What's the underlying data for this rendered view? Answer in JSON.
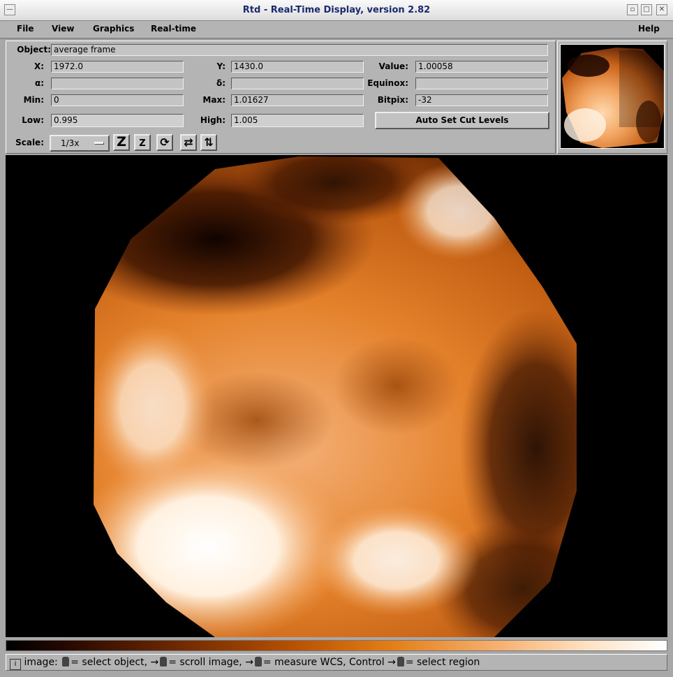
{
  "window": {
    "title": "Rtd - Real-Time Display, version 2.82"
  },
  "menu": {
    "file": "File",
    "view": "View",
    "graphics": "Graphics",
    "realtime": "Real-time",
    "help": "Help"
  },
  "info": {
    "object_label": "Object:",
    "object_value": "average frame",
    "x_label": "X:",
    "x_value": "1972.0",
    "y_label": "Y:",
    "y_value": "1430.0",
    "value_label": "Value:",
    "value_value": "1.00058",
    "alpha_label": "α:",
    "alpha_value": "",
    "delta_label": "δ:",
    "delta_value": "",
    "equinox_label": "Equinox:",
    "equinox_value": "",
    "min_label": "Min:",
    "min_value": "0",
    "max_label": "Max:",
    "max_value": "1.01627",
    "bitpix_label": "Bitpix:",
    "bitpix_value": "-32",
    "low_label": "Low:",
    "low_value": "0.995",
    "high_label": "High:",
    "high_value": "1.005",
    "autocut_label": "Auto Set Cut Levels",
    "scale_label": "Scale:",
    "scale_value": "1/3x"
  },
  "icons": [
    "zoom-in-icon",
    "zoom-out-icon",
    "rotate-icon",
    "flip-x-icon",
    "flip-y-icon"
  ],
  "colors": {
    "bg": "#b4b4b4",
    "image_orange": "#e07020",
    "title_text": "#1a2a6c"
  },
  "status": {
    "prefix": "image:",
    "t1": "= select object,",
    "t2": "= scroll image,",
    "t3": "= measure WCS, Control",
    "t4": "= select region"
  }
}
